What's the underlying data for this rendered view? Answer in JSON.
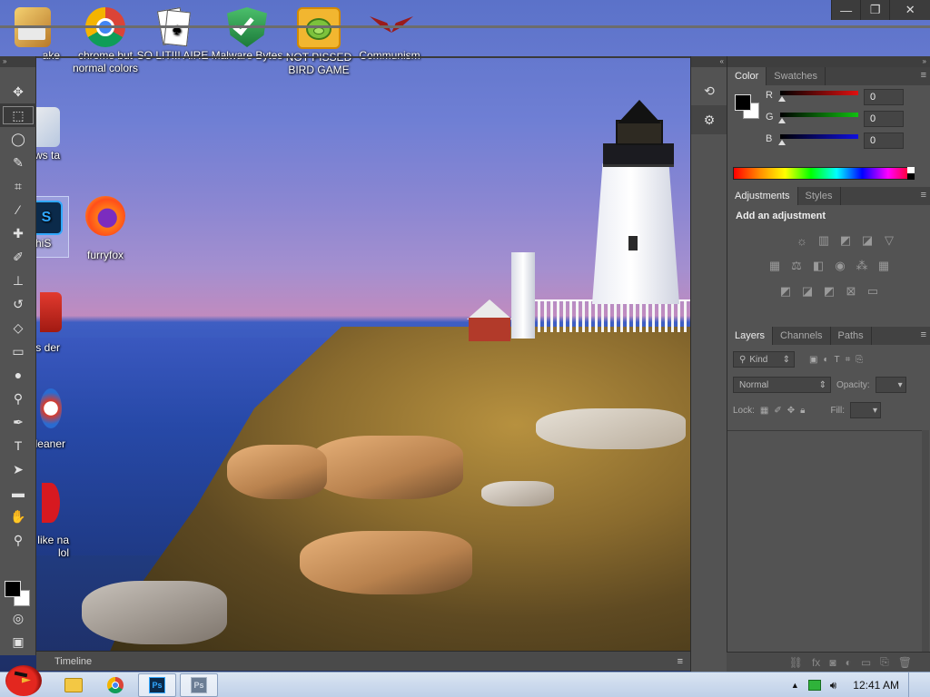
{
  "desktop": {
    "icons": [
      {
        "label": "ake",
        "icon": "gift-box-icon"
      },
      {
        "label": "chrome but normal colors",
        "icon": "chrome-icon"
      },
      {
        "label": "SO LIT!!! AIRE",
        "icon": "solitaire-cards-icon"
      },
      {
        "label": "Malware Bytes",
        "icon": "shield-check-icon"
      },
      {
        "label": "NOT PISSED BIRD GAME",
        "icon": "green-pig-icon"
      },
      {
        "label": "Communism",
        "icon": "winged-emblem-icon"
      },
      {
        "label": "lows ta",
        "icon": "windows-logo-icon"
      },
      {
        "label": "hiS",
        "icon": "photoshop-icon"
      },
      {
        "label": "furryfox",
        "icon": "firefox-icon"
      },
      {
        "label": "bius der",
        "icon": "pdf-reader-icon"
      },
      {
        "label": "leaner",
        "icon": "ccleaner-icon"
      },
      {
        "label": "oks like na lol",
        "icon": "opera-icon"
      }
    ]
  },
  "window_controls": {
    "minimize": "—",
    "restore": "❐",
    "close": "✕"
  },
  "timeline": {
    "label": "Timeline"
  },
  "color_panel": {
    "tabs": [
      "Color",
      "Swatches"
    ],
    "active_tab": "Color",
    "channels": [
      {
        "label": "R",
        "value": "0",
        "color": "#e01010"
      },
      {
        "label": "G",
        "value": "0",
        "color": "#10c010"
      },
      {
        "label": "B",
        "value": "0",
        "color": "#1010e0"
      }
    ]
  },
  "adjustments_panel": {
    "tabs": [
      "Adjustments",
      "Styles"
    ],
    "title": "Add an adjustment"
  },
  "layers_panel": {
    "tabs": [
      "Layers",
      "Channels",
      "Paths"
    ],
    "kind_label": "Kind",
    "blend_mode": "Normal",
    "opacity_label": "Opacity:",
    "lock_label": "Lock:",
    "fill_label": "Fill:"
  },
  "taskbar": {
    "clock": "12:41 AM"
  },
  "colors": {
    "ps_panel": "#535353",
    "ps_dark": "#424242",
    "taskbar": "#d9e4f2"
  }
}
